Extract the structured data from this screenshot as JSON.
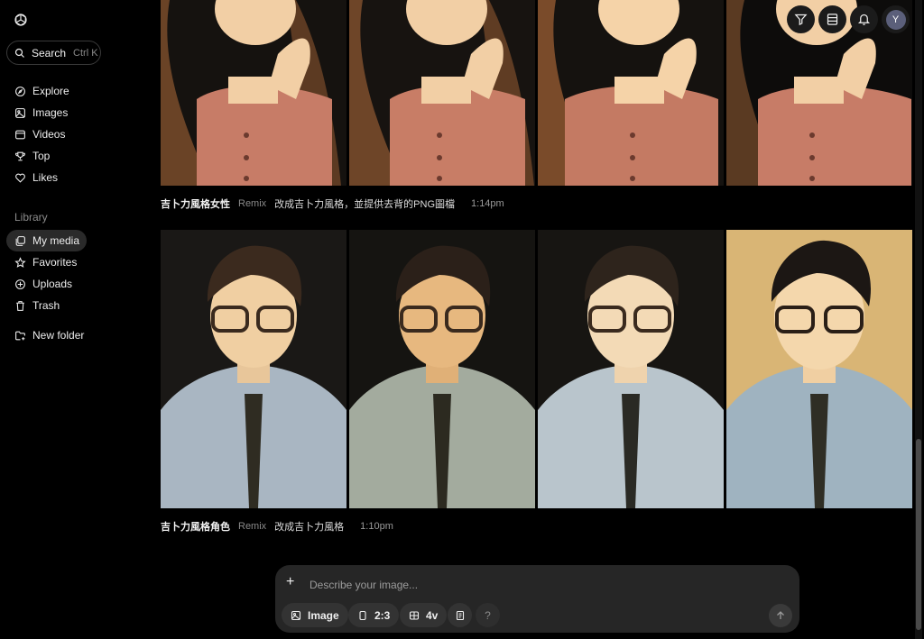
{
  "sidebar": {
    "search": {
      "label": "Search",
      "shortcut": "Ctrl K"
    },
    "nav": [
      {
        "label": "Explore",
        "icon": "compass-icon"
      },
      {
        "label": "Images",
        "icon": "image-icon"
      },
      {
        "label": "Videos",
        "icon": "video-icon"
      },
      {
        "label": "Top",
        "icon": "trophy-icon"
      },
      {
        "label": "Likes",
        "icon": "heart-icon"
      }
    ],
    "library_label": "Library",
    "library": [
      {
        "label": "My media",
        "icon": "media-icon",
        "active": true
      },
      {
        "label": "Favorites",
        "icon": "star-icon"
      },
      {
        "label": "Uploads",
        "icon": "upload-icon"
      },
      {
        "label": "Trash",
        "icon": "trash-icon"
      }
    ],
    "new_folder": "New folder"
  },
  "topbar": {
    "avatar_initial": "Y"
  },
  "gallery": [
    {
      "title": "吉卜力風格女性",
      "remix": "Remix",
      "prompt": "改成吉卜力風格，並提供去背的PNG圖檔",
      "time": "1:14pm"
    },
    {
      "title": "吉卜力風格角色",
      "remix": "Remix",
      "prompt": "改成吉卜力風格",
      "time": "1:10pm"
    }
  ],
  "composer": {
    "placeholder": "Describe your image...",
    "type_label": "Image",
    "ratio_label": "2:3",
    "variants_label": "4v",
    "help_label": "?"
  },
  "colors": {
    "background": "#000000",
    "composer": "#262626",
    "chip": "#333333"
  }
}
